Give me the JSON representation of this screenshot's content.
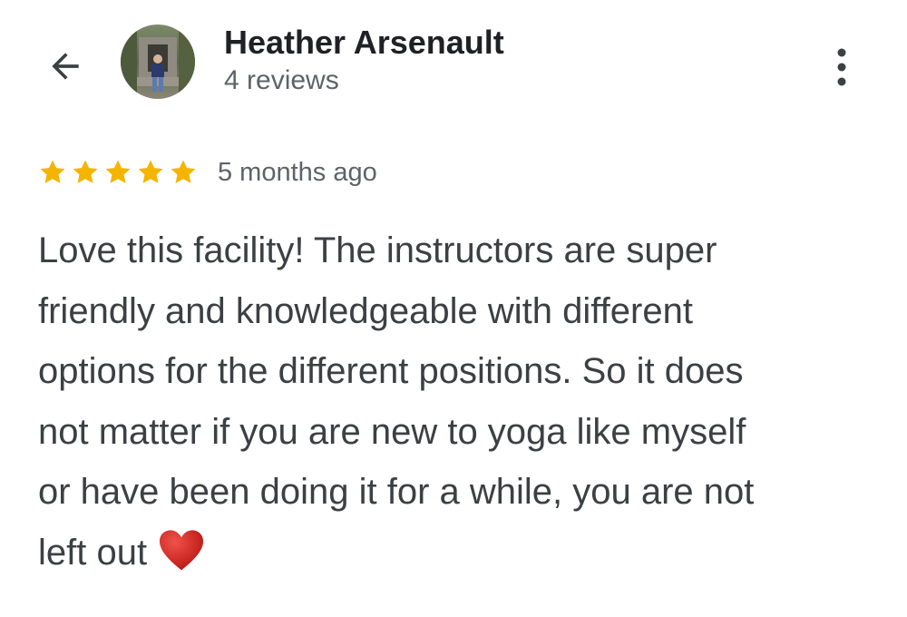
{
  "header": {
    "reviewer_name": "Heather Arsenault",
    "review_count": "4 reviews",
    "back_icon": "arrow-back-icon",
    "more_icon": "more-vert-icon"
  },
  "review": {
    "rating": 5,
    "rating_max": 5,
    "time_ago": "5 months ago",
    "lines": [
      "Love this facility! The instructors are super",
      "friendly and knowledgeable with different",
      "options for the different positions. So it does",
      "not matter if you are new to yoga like myself",
      "or have been doing it for a while, you are not",
      "left out"
    ],
    "emoji": "heart-emoji"
  },
  "colors": {
    "star": "#f4b400",
    "heart": "#d3201d",
    "name": "#202124",
    "text": "#3c4043",
    "secondary": "#5f6368"
  }
}
